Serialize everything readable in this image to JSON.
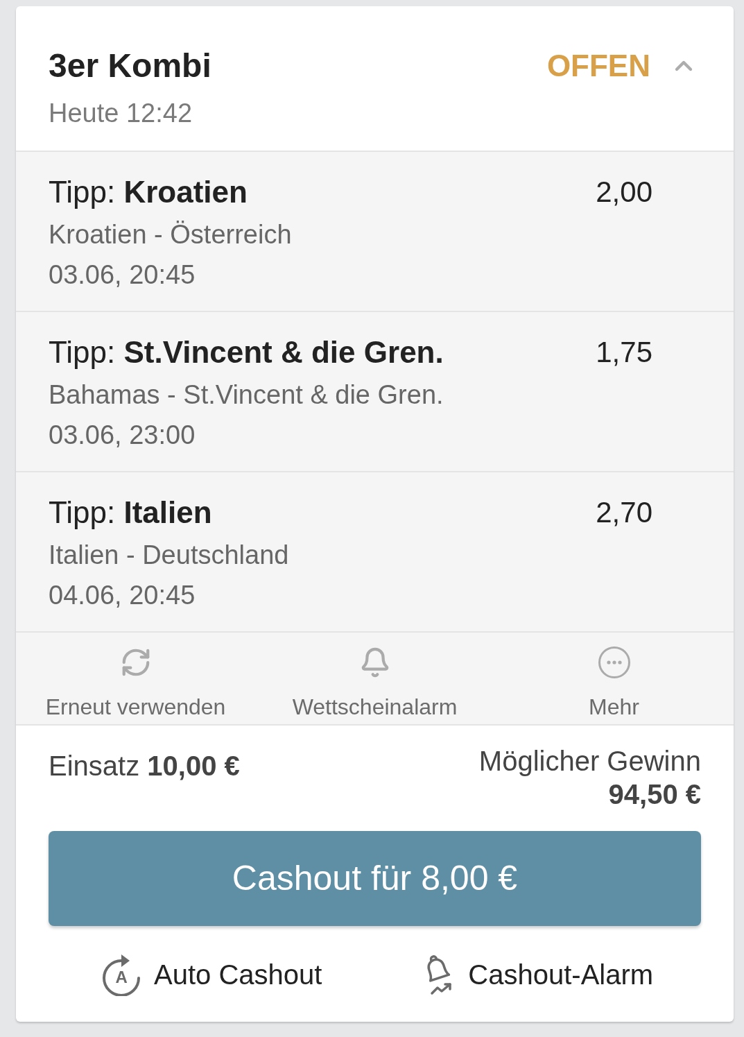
{
  "bet": {
    "title": "3er Kombi",
    "placed": "Heute 12:42",
    "status": {
      "label": "OFFEN",
      "kind": "open"
    },
    "expanded": true
  },
  "selections": [
    {
      "tip": "Tipp: **Kroatien**",
      "odds": "2,00",
      "match": "Kroatien - Österreich",
      "kickoff": "03.06, 20:45"
    },
    {
      "tip": "Tipp: **St.Vincent & die Gren.**",
      "odds": "1,75",
      "match": "Bahamas - St.Vincent & die Gren.",
      "kickoff": "03.06, 23:00"
    },
    {
      "tip": "Tipp: **Italien**",
      "odds": "2,70",
      "match": "Italien - Deutschland",
      "kickoff": "04.06, 20:45"
    }
  ],
  "actions": [
    {
      "kind": "reuse",
      "label": "Erneut verwenden"
    },
    {
      "kind": "alarm",
      "label": "Wettscheinalarm"
    },
    {
      "kind": "more",
      "label": "Mehr"
    }
  ],
  "summary": {
    "stake": "Einsatz **10,00 €**",
    "potential_win_label": "Möglicher Gewinn",
    "potential_win": "94,50 €"
  },
  "cashout_button": "Cashout für 8,00 €",
  "cashout_options": [
    {
      "kind": "auto",
      "label": "Auto Cashout",
      "icon_letter": "A"
    },
    {
      "kind": "alarm",
      "label": "Cashout-Alarm"
    }
  ]
}
